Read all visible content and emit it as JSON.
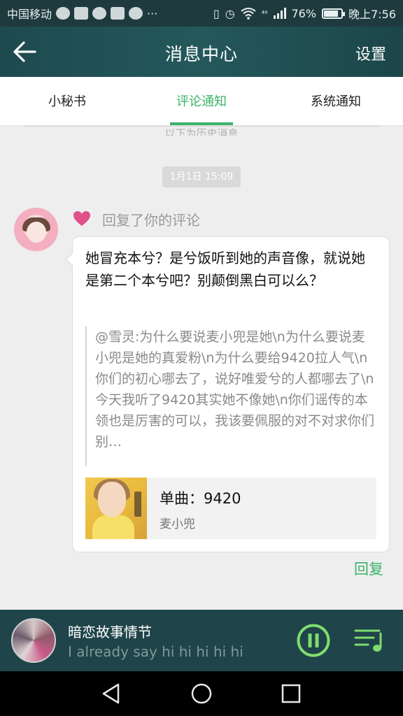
{
  "status_bar": {
    "carrier": "中国移动",
    "network": "⁴⁶",
    "battery": "76%",
    "battery_level": 0.76,
    "time": "晚上7:56"
  },
  "header": {
    "title": "消息中心",
    "settings_label": "设置",
    "back_icon": "arrow-left-icon"
  },
  "tabs": [
    {
      "label": "小秘书",
      "active": false
    },
    {
      "label": "评论通知",
      "active": true
    },
    {
      "label": "系统通知",
      "active": false
    }
  ],
  "history_divider": "以下为历史消息",
  "timestamp": "1月1日 15:09",
  "notification": {
    "action": "回复了你的评论",
    "comment": "她冒充本兮？是兮饭听到她的声音像，就说她是第二个本兮吧？别颠倒黑白可以么？",
    "quoted": "@雪灵:为什么要说麦小兜是她\\n为什么要说麦小兜是她的真爱粉\\n为什么要给9420拉人气\\n你们的初心哪去了，说好唯爱兮的人都哪去了\\n今天我听了9420其实她不像她\\n你们谣传的本领也是厉害的可以，我该要佩服的对不对求你们别…",
    "song_title": "单曲：9420",
    "song_artist": "麦小兜",
    "reply_label": "回复"
  },
  "player": {
    "title": "暗恋故事情节",
    "lyric": "I already say hi hi hi hi hi"
  },
  "colors": {
    "accent": "#3bb36a",
    "header_bg": "#24585b",
    "heart": "#e0508a"
  }
}
